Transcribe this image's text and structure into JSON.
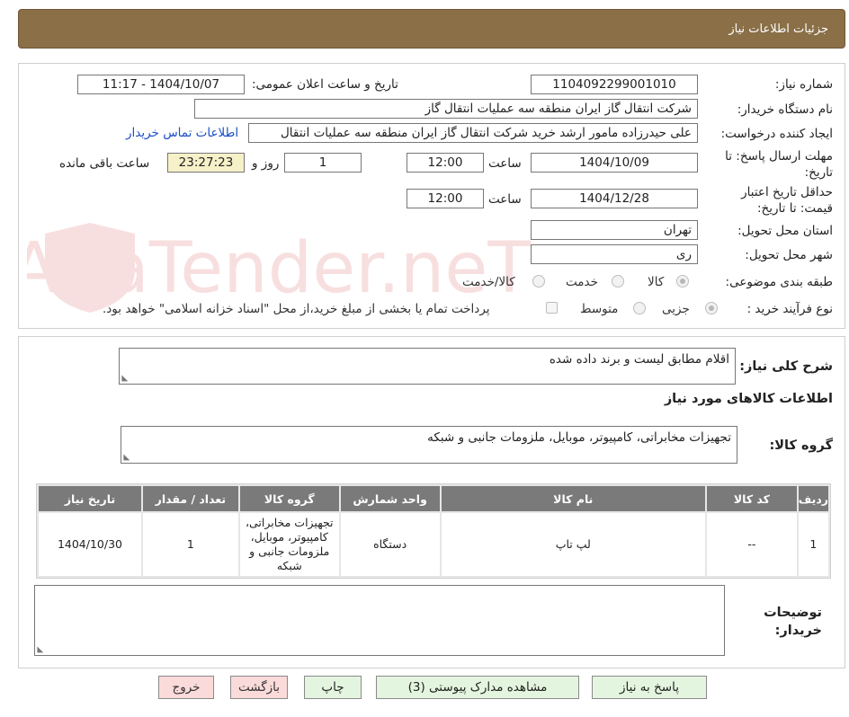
{
  "header": {
    "title": "جزئیات اطلاعات نیاز"
  },
  "fields": {
    "need_number_label": "شماره نیاز:",
    "need_number": "1104092299001010",
    "announce_label": "تاریخ و ساعت اعلان عمومی:",
    "announce_value": "1404/10/07 - 11:17",
    "buyer_org_label": "نام دستگاه خریدار:",
    "buyer_org": "شرکت انتقال گاز ایران منطقه سه عملیات انتقال گاز",
    "requester_label": "ایجاد کننده درخواست:",
    "requester": "علی حیدرزاده مامور ارشد خرید شرکت انتقال گاز ایران منطقه سه عملیات انتقال",
    "contact_link": "اطلاعات تماس خریدار",
    "deadline_label": "مهلت ارسال پاسخ: تا تاریخ:",
    "deadline_date": "1404/10/09",
    "time_label": "ساعت",
    "deadline_time": "12:00",
    "days": "1",
    "days_label": "روز و",
    "remaining": "23:27:23",
    "remaining_label": "ساعت باقی مانده",
    "price_validity_label": "حداقل تاریخ اعتبار قیمت: تا تاریخ:",
    "price_validity_date": "1404/12/28",
    "price_validity_time": "12:00",
    "province_label": "استان محل تحویل:",
    "province": "تهران",
    "city_label": "شهر محل تحویل:",
    "city": "ری",
    "category_label": "طبقه بندی موضوعی:",
    "category_options": [
      "کالا",
      "خدمت",
      "کالا/خدمت"
    ],
    "process_label": "نوع فرآیند خرید :",
    "process_options": [
      "جزیی",
      "متوسط"
    ],
    "payment_note": "پرداخت تمام یا بخشی از مبلغ خرید،از محل \"اسناد خزانه اسلامی\" خواهد بود."
  },
  "description": {
    "label": "شرح کلی نیاز:",
    "value": "اقلام مطابق لیست و برند داده شده"
  },
  "goods": {
    "section_title": "اطلاعات کالاهای مورد نیاز",
    "group_label": "گروه کالا:",
    "group_value": "تجهیزات مخابراتی، کامپیوتر، موبایل، ملزومات جانبی و شبکه"
  },
  "table": {
    "headers": [
      "ردیف",
      "کد کالا",
      "نام کالا",
      "واحد شمارش",
      "گروه کالا",
      "تعداد / مقدار",
      "تاریخ نیاز"
    ],
    "rows": [
      [
        "1",
        "--",
        "لپ تاپ",
        "دستگاه",
        "تجهیزات مخابراتی، کامپیوتر، موبایل، ملزومات جانبی و شبکه",
        "1",
        "1404/10/30"
      ]
    ]
  },
  "buyer_notes_label": "توضیحات خریدار:",
  "buttons": {
    "reply": "پاسخ به نیاز",
    "attachments": "مشاهده مدارک پیوستی (3)",
    "print": "چاپ",
    "back": "بازگشت",
    "exit": "خروج"
  },
  "watermark_text": "AriaTender.neT"
}
